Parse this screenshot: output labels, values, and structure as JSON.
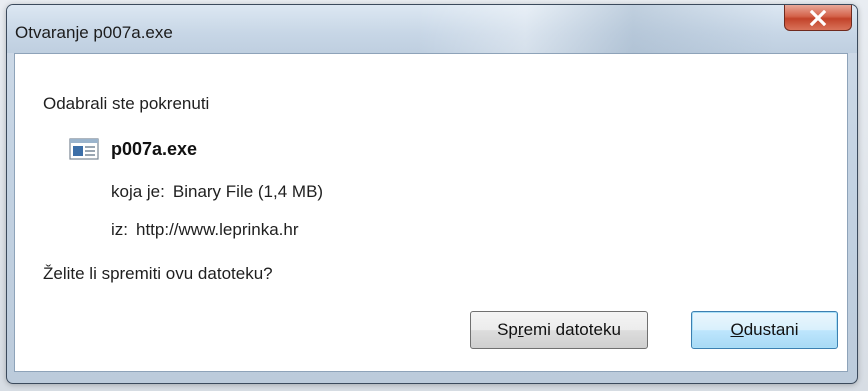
{
  "window": {
    "title": "Otvaranje p007a.exe"
  },
  "dialog": {
    "intro": "Odabrali ste pokrenuti",
    "file_name": "p007a.exe",
    "type_label": "koja je:",
    "type_value": "Binary File (1,4 MB)",
    "from_label": "iz:",
    "from_value": "http://www.leprinka.hr",
    "question": "Želite li spremiti ovu datoteku?"
  },
  "buttons": {
    "save_prefix": "Sp",
    "save_accel": "r",
    "save_suffix": "emi datoteku",
    "cancel_accel": "O",
    "cancel_suffix": "dustani"
  },
  "icons": {
    "close": "close-icon",
    "file": "executable-file-icon"
  },
  "colors": {
    "close_button": "#c2432a",
    "default_button_border": "#3c7fb1"
  }
}
